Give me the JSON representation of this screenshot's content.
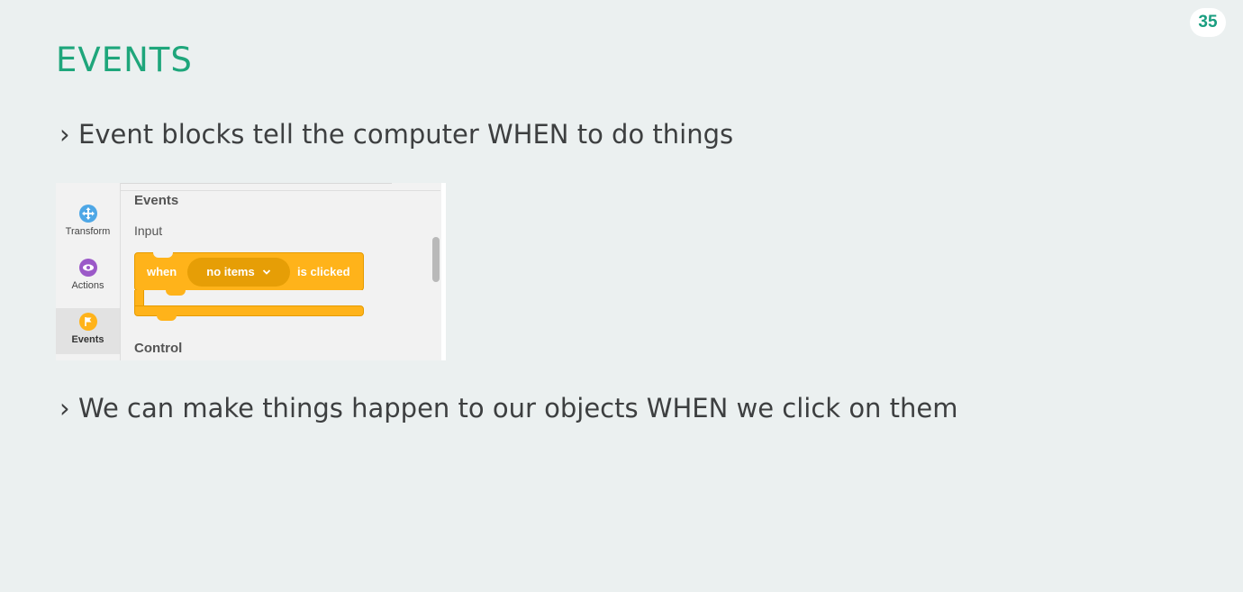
{
  "slide": {
    "page_number": "35",
    "title": "EVENTS",
    "bullet_marker": "›",
    "bullets": [
      "Event blocks tell the computer WHEN to do things",
      "We can make things happen to our objects WHEN we click on them"
    ]
  },
  "editor": {
    "categories": [
      {
        "label": "Transform",
        "icon": "move-arrows-icon",
        "color": "#4ea7e6"
      },
      {
        "label": "Actions",
        "icon": "eye-icon",
        "color": "#9b59c8"
      },
      {
        "label": "Events",
        "icon": "flag-icon",
        "color": "#ffb31a",
        "selected": true
      }
    ],
    "section_title": "Events",
    "subsection": "Input",
    "next_section": "Control",
    "block": {
      "prefix": "when",
      "dropdown_value": "no items",
      "dropdown_icon": "chevron-down-icon",
      "suffix": "is clicked",
      "color": "#ffb31a"
    }
  },
  "colors": {
    "background": "#ebf0f0",
    "title": "#1ea67b",
    "text": "#3d3f40",
    "page_number": "#1a9e80"
  }
}
